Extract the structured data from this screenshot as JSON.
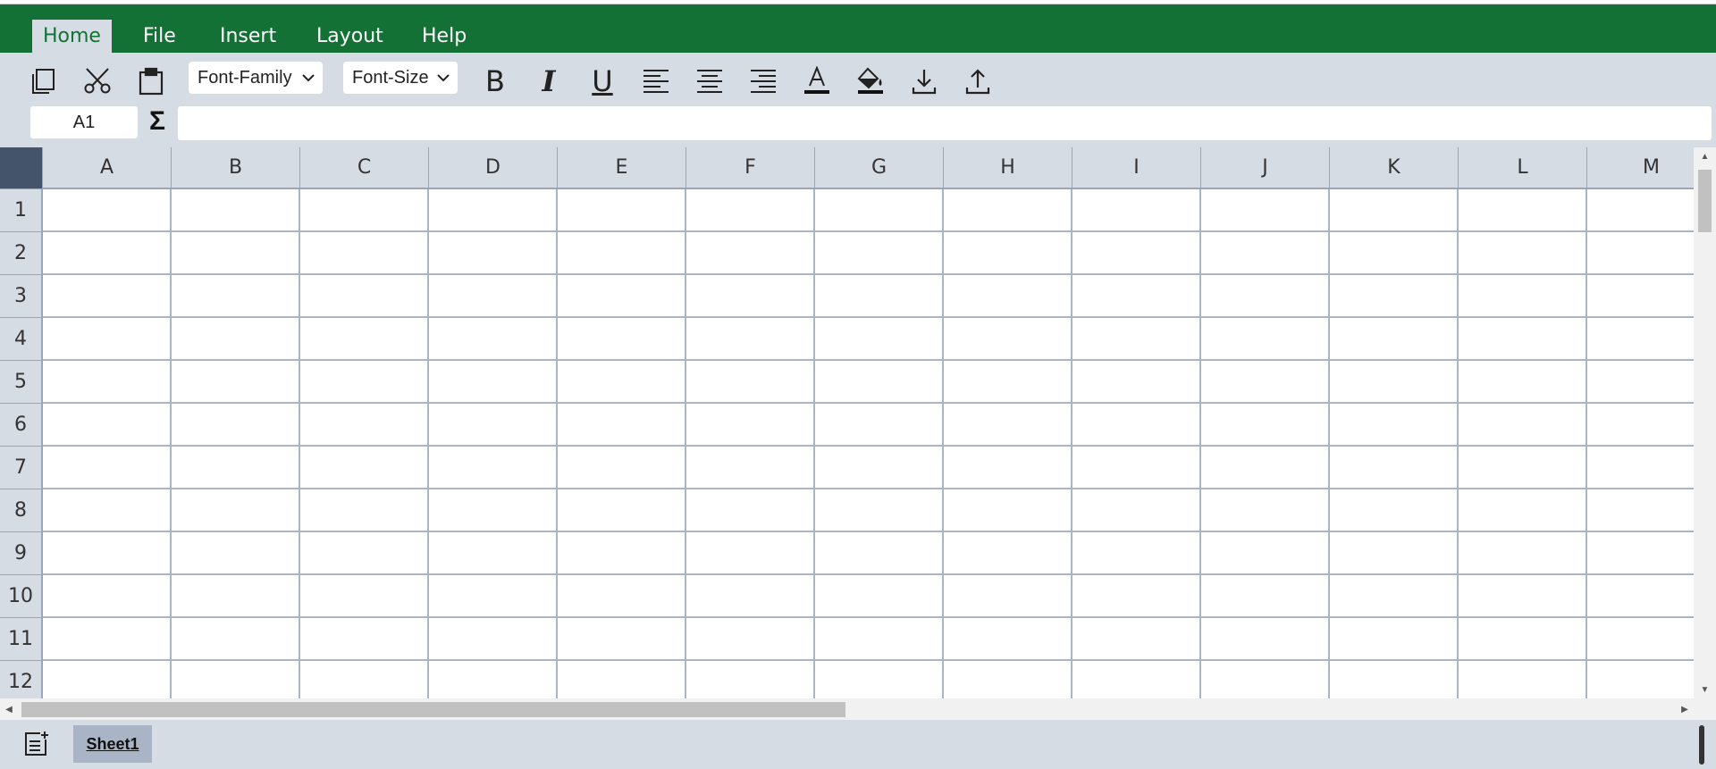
{
  "menu": {
    "items": [
      {
        "label": "Home",
        "active": true
      },
      {
        "label": "File",
        "active": false
      },
      {
        "label": "Insert",
        "active": false
      },
      {
        "label": "Layout",
        "active": false
      },
      {
        "label": "Help",
        "active": false
      }
    ]
  },
  "toolbar": {
    "font_family": "Font-Family",
    "font_size": "Font-Size",
    "bold": "B",
    "italic": "I",
    "underline": "U",
    "icons": [
      "copy-icon",
      "cut-icon",
      "paste-icon",
      "chevron-down-icon",
      "align-left-icon",
      "align-center-icon",
      "align-right-icon",
      "font-color-icon",
      "fill-color-icon",
      "download-icon",
      "upload-icon"
    ]
  },
  "formula_bar": {
    "name_box": "A1",
    "sigma": "Σ",
    "formula_value": ""
  },
  "grid": {
    "columns": [
      "A",
      "B",
      "C",
      "D",
      "E",
      "F",
      "G",
      "H",
      "I",
      "J",
      "K",
      "L",
      "M"
    ],
    "rows": [
      "1",
      "2",
      "3",
      "4",
      "5",
      "6",
      "7",
      "8",
      "9",
      "10",
      "11",
      "12"
    ]
  },
  "sheets": {
    "tabs": [
      "Sheet1"
    ],
    "active": "Sheet1"
  },
  "colors": {
    "menu_bar": "#137135",
    "toolbar_bg": "#d6dce4",
    "corner_header": "#44546a",
    "grid_line": "#aab5c4"
  }
}
